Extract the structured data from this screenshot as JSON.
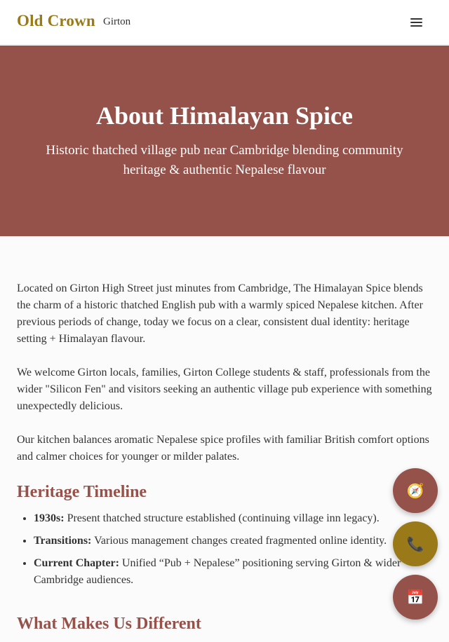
{
  "header": {
    "brand": "Old Crown",
    "location": "Girton",
    "menu_icon": "hamburger-menu-icon"
  },
  "hero": {
    "title": "About Himalayan Spice",
    "subtitle": "Historic thatched village pub near Cambridge blending community heritage & authentic Nepalese flavour"
  },
  "intro": [
    "Located on Girton High Street just minutes from Cambridge, The Himalayan Spice blends the charm of a historic thatched English pub with a warmly spiced Nepalese kitchen. After previous periods of change, today we focus on a clear, consistent dual identity: heritage setting + Himalayan flavour.",
    "We welcome Girton locals, families, Girton College students & staff, professionals from the wider \"Silicon Fen\" and visitors seeking an authentic village pub experience with something unexpectedly delicious.",
    "Our kitchen balances aromatic Nepalese spice profiles with familiar British comfort options and calmer choices for younger or milder palates."
  ],
  "timeline": {
    "heading": "Heritage Timeline",
    "items": [
      {
        "label": "1930s:",
        "text": " Present thatched structure established (continuing village inn legacy)."
      },
      {
        "label": "Transitions:",
        "text": " Various management changes created fragmented online identity."
      },
      {
        "label": "Current Chapter:",
        "text": " Unified “Pub + Nepalese” positioning serving Girton & wider Cambridge audiences."
      }
    ]
  },
  "next_heading": "What Makes Us Different",
  "fabs": {
    "directions_icon": "🧭",
    "call_icon": "📞",
    "booking_icon": "📅"
  },
  "colors": {
    "brand_gold": "#9a7a18",
    "accent_red": "#95524a"
  }
}
